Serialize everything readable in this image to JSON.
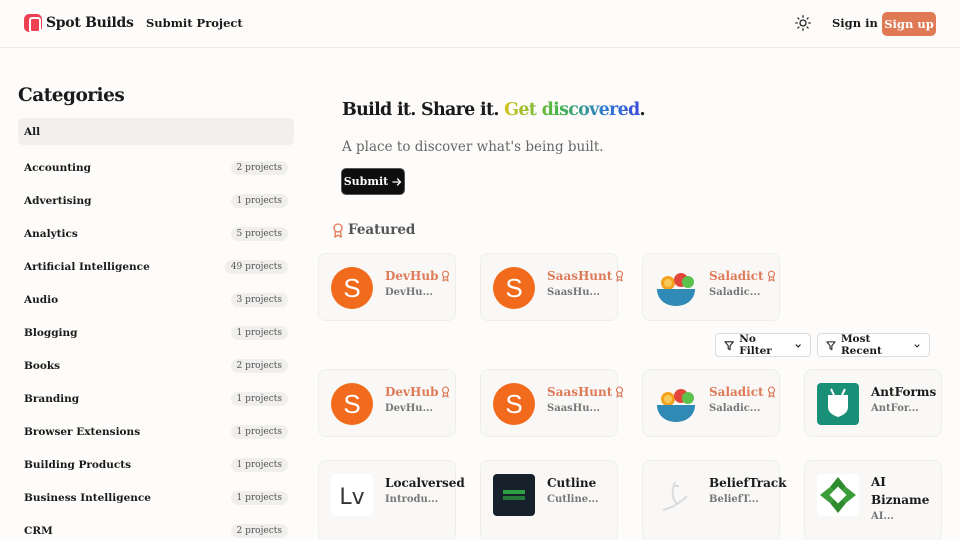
{
  "header": {
    "brand": "Spot Builds",
    "nav_submit": "Submit Project",
    "signin": "Sign in",
    "signup": "Sign up",
    "theme_icon": "sun-icon"
  },
  "sidebar": {
    "title": "Categories",
    "items": [
      {
        "label": "All",
        "count": ""
      },
      {
        "label": "Accounting",
        "count": "2 projects"
      },
      {
        "label": "Advertising",
        "count": "1 projects"
      },
      {
        "label": "Analytics",
        "count": "5 projects"
      },
      {
        "label": "Artificial Intelligence",
        "count": "49 projects"
      },
      {
        "label": "Audio",
        "count": "3 projects"
      },
      {
        "label": "Blogging",
        "count": "1 projects"
      },
      {
        "label": "Books",
        "count": "2 projects"
      },
      {
        "label": "Branding",
        "count": "1 projects"
      },
      {
        "label": "Browser Extensions",
        "count": "1 projects"
      },
      {
        "label": "Building Products",
        "count": "1 projects"
      },
      {
        "label": "Business Intelligence",
        "count": "1 projects"
      },
      {
        "label": "CRM",
        "count": "2 projects"
      }
    ]
  },
  "hero": {
    "title_part1": "Build it. Share it. ",
    "title_highlight": "Get discovered",
    "title_end": ".",
    "subtitle": "A place to discover what's being built.",
    "submit": "Submit"
  },
  "featured": {
    "label": "Featured",
    "cards": [
      {
        "name": "DevHub",
        "desc": "DevHu..."
      },
      {
        "name": "SaasHunt",
        "desc": "SaasHu..."
      },
      {
        "name": "Saladict",
        "desc": "Saladic..."
      }
    ]
  },
  "filters": {
    "filter_label": "No Filter",
    "sort_label": "Most Recent"
  },
  "projects": {
    "row1": [
      {
        "name": "DevHub",
        "desc": "DevHu..."
      },
      {
        "name": "SaasHunt",
        "desc": "SaasHu..."
      },
      {
        "name": "Saladict",
        "desc": "Saladic..."
      },
      {
        "name": "AntForms",
        "desc": "AntFor..."
      }
    ],
    "row2": [
      {
        "name": "Localversed",
        "desc": "Introdu..."
      },
      {
        "name": "Cutline",
        "desc": "Cutline..."
      },
      {
        "name": "BeliefTrack",
        "desc": "BeliefT..."
      },
      {
        "name": "AI Bizname",
        "desc": "AI..."
      }
    ]
  },
  "colors": {
    "accent": "#df7a55",
    "brand": "#ef3f52",
    "featured_name": "#de7a58"
  }
}
